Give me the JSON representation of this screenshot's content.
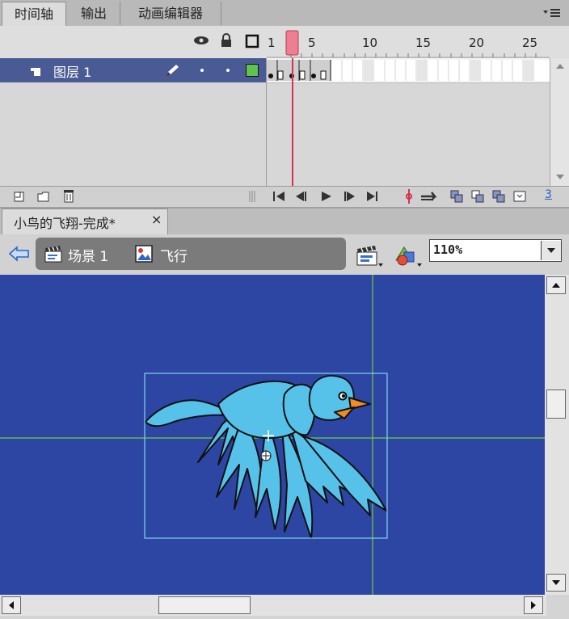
{
  "panel_tabs": [
    {
      "label": "时间轴",
      "active": true
    },
    {
      "label": "输出",
      "active": false
    },
    {
      "label": "动画编辑器",
      "active": false
    }
  ],
  "timeline": {
    "ruler_numbers": [
      "1",
      "5",
      "10",
      "15",
      "20",
      "25"
    ],
    "current_frame": 3,
    "layer_name": "图层 1",
    "fps_fragment": "3"
  },
  "document": {
    "tab_title": "小鸟的飞翔-完成*",
    "close_glyph": "×",
    "breadcrumb": {
      "scene": "场景 1",
      "symbol": "飞行"
    },
    "zoom": "110%"
  },
  "colors": {
    "stage_bg": "#2e46a3",
    "layer_selected": "#4a5a94",
    "playhead": "#e06070",
    "guide": "#6fcf3f",
    "bird_body": "#56c2ea",
    "beak": "#f08c22"
  }
}
